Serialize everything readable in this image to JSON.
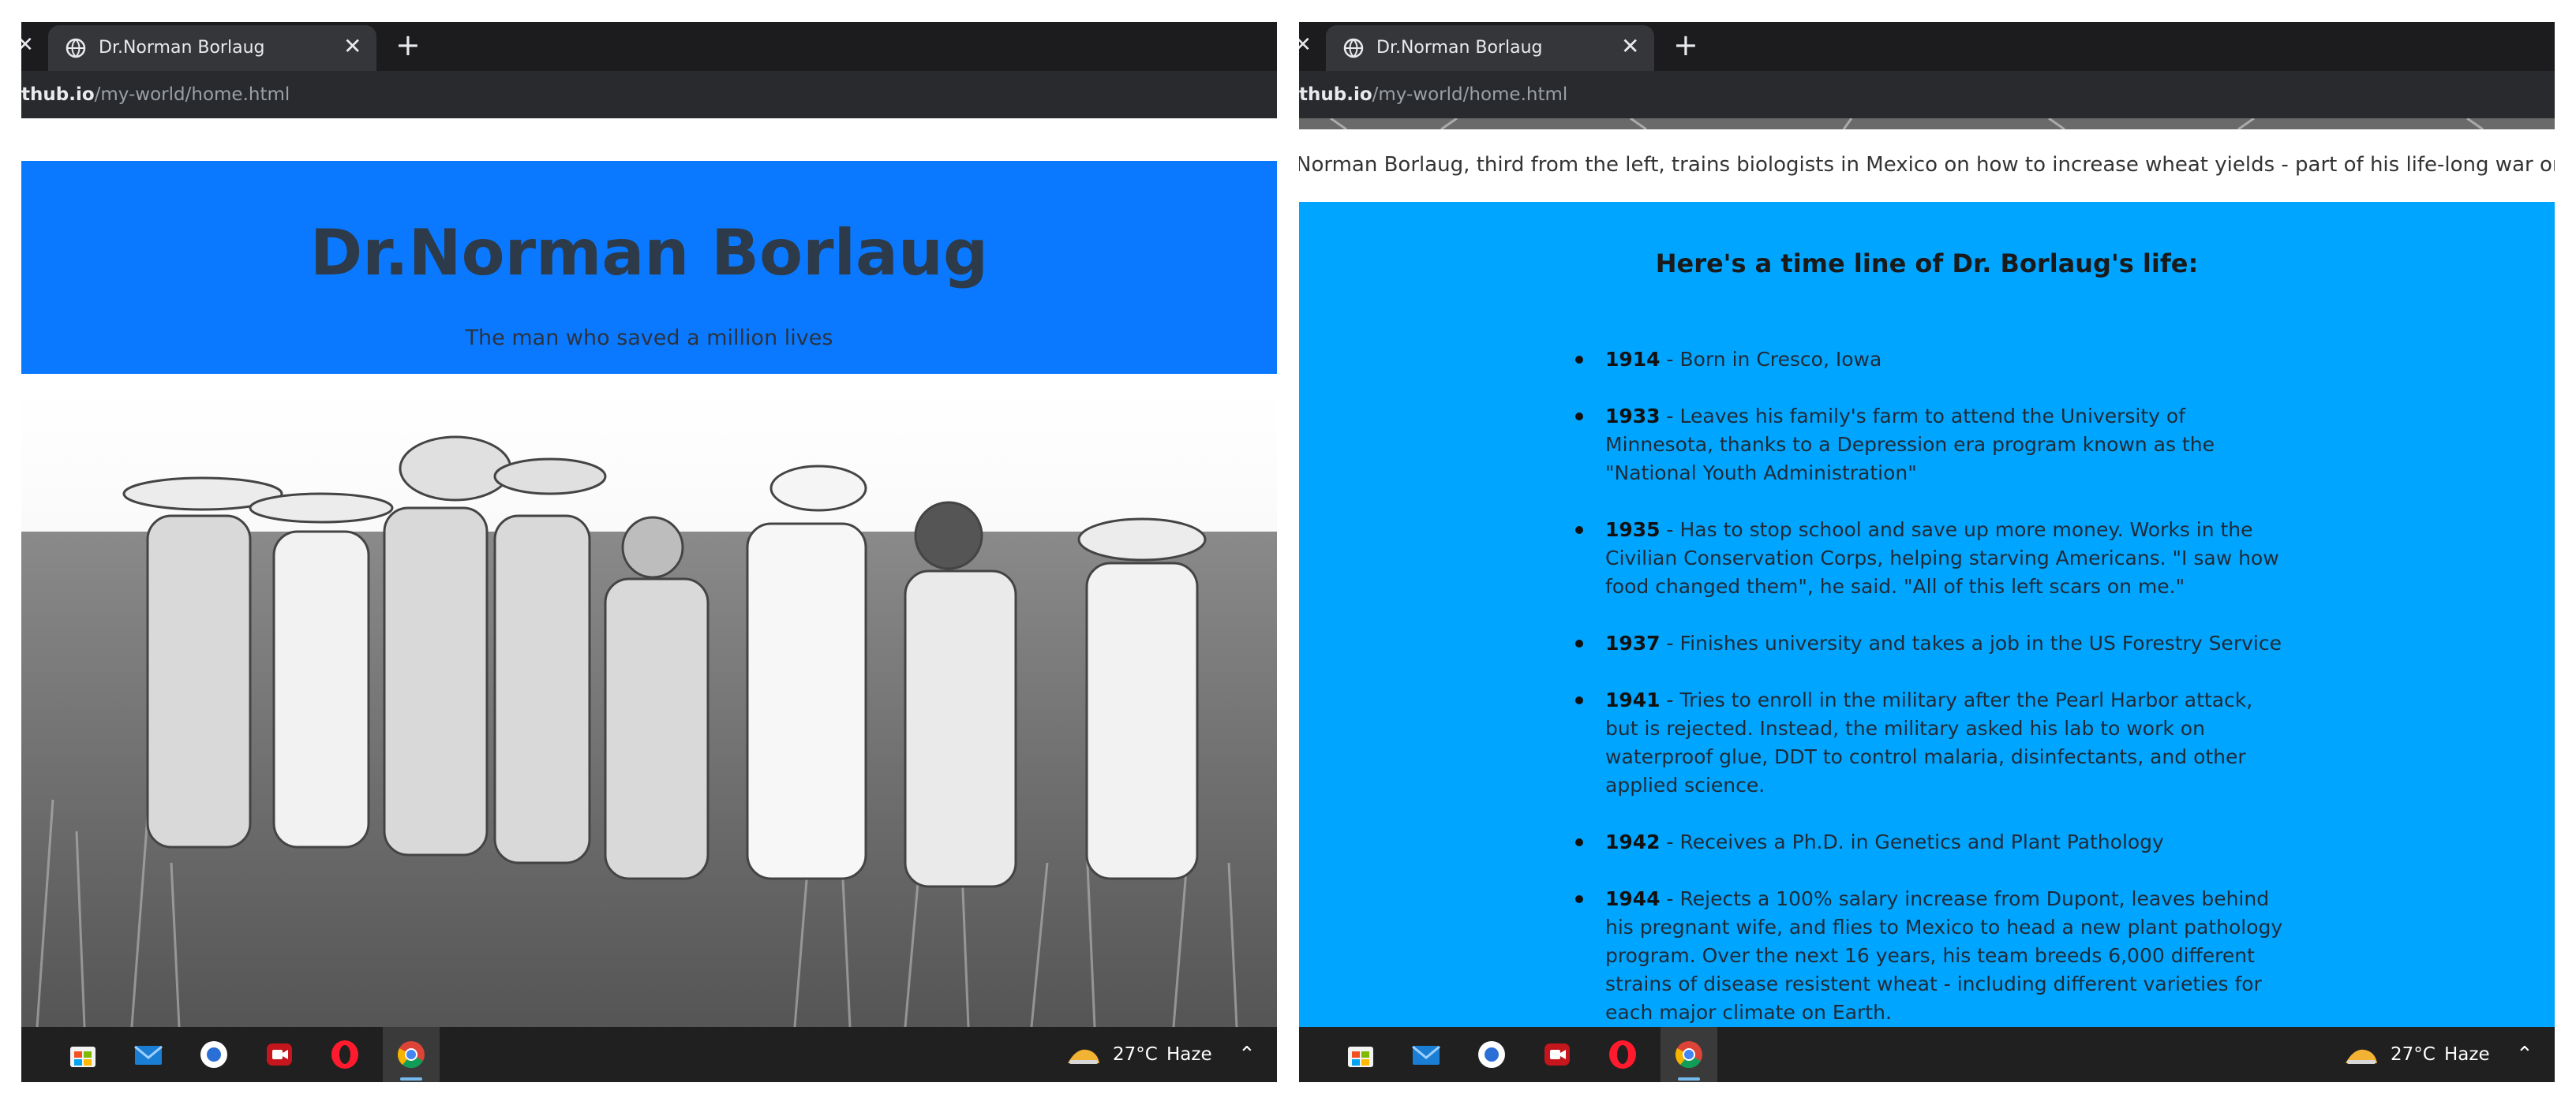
{
  "tab": {
    "title": "Dr.Norman Borlaug"
  },
  "address": {
    "host": "thub.io",
    "path": "/my-world/home.html"
  },
  "taskbar": {
    "temperature": "27°C",
    "condition": "Haze",
    "apps": [
      "microsoft-store-icon",
      "mail-icon",
      "photos-icon",
      "camera-app-icon",
      "opera-icon",
      "chrome-icon"
    ]
  },
  "left_page": {
    "title": "Dr.Norman Borlaug",
    "subtitle": "The man who saved a million lives"
  },
  "right_page": {
    "caption": "Norman Borlaug, third from the left, trains biologists in Mexico on how to increase wheat yields - part of his life-long war on hung",
    "timeline_heading": "Here's a time line of Dr. Borlaug's life:",
    "timeline": [
      {
        "year": "1914",
        "text": " - Born in Cresco, Iowa"
      },
      {
        "year": "1933",
        "text": " - Leaves his family's farm to attend the University of Minnesota, thanks to a Depression era program known as the \"National Youth Administration\""
      },
      {
        "year": "1935",
        "text": " - Has to stop school and save up more money. Works in the Civilian Conservation Corps, helping starving Americans. \"I saw how food changed them\", he said. \"All of this left scars on me.\""
      },
      {
        "year": "1937",
        "text": " - Finishes university and takes a job in the US Forestry Service"
      },
      {
        "year": "1941",
        "text": " - Tries to enroll in the military after the Pearl Harbor attack, but is rejected. Instead, the military asked his lab to work on waterproof glue, DDT to control malaria, disinfectants, and other applied science."
      },
      {
        "year": "1942",
        "text": " - Receives a Ph.D. in Genetics and Plant Pathology"
      },
      {
        "year": "1944",
        "text": " - Rejects a 100% salary increase from Dupont, leaves behind his pregnant wife, and flies to Mexico to head a new plant pathology program. Over the next 16 years, his team breeds 6,000 different strains of disease resistent wheat - including different varieties for each major climate on Earth."
      }
    ]
  }
}
